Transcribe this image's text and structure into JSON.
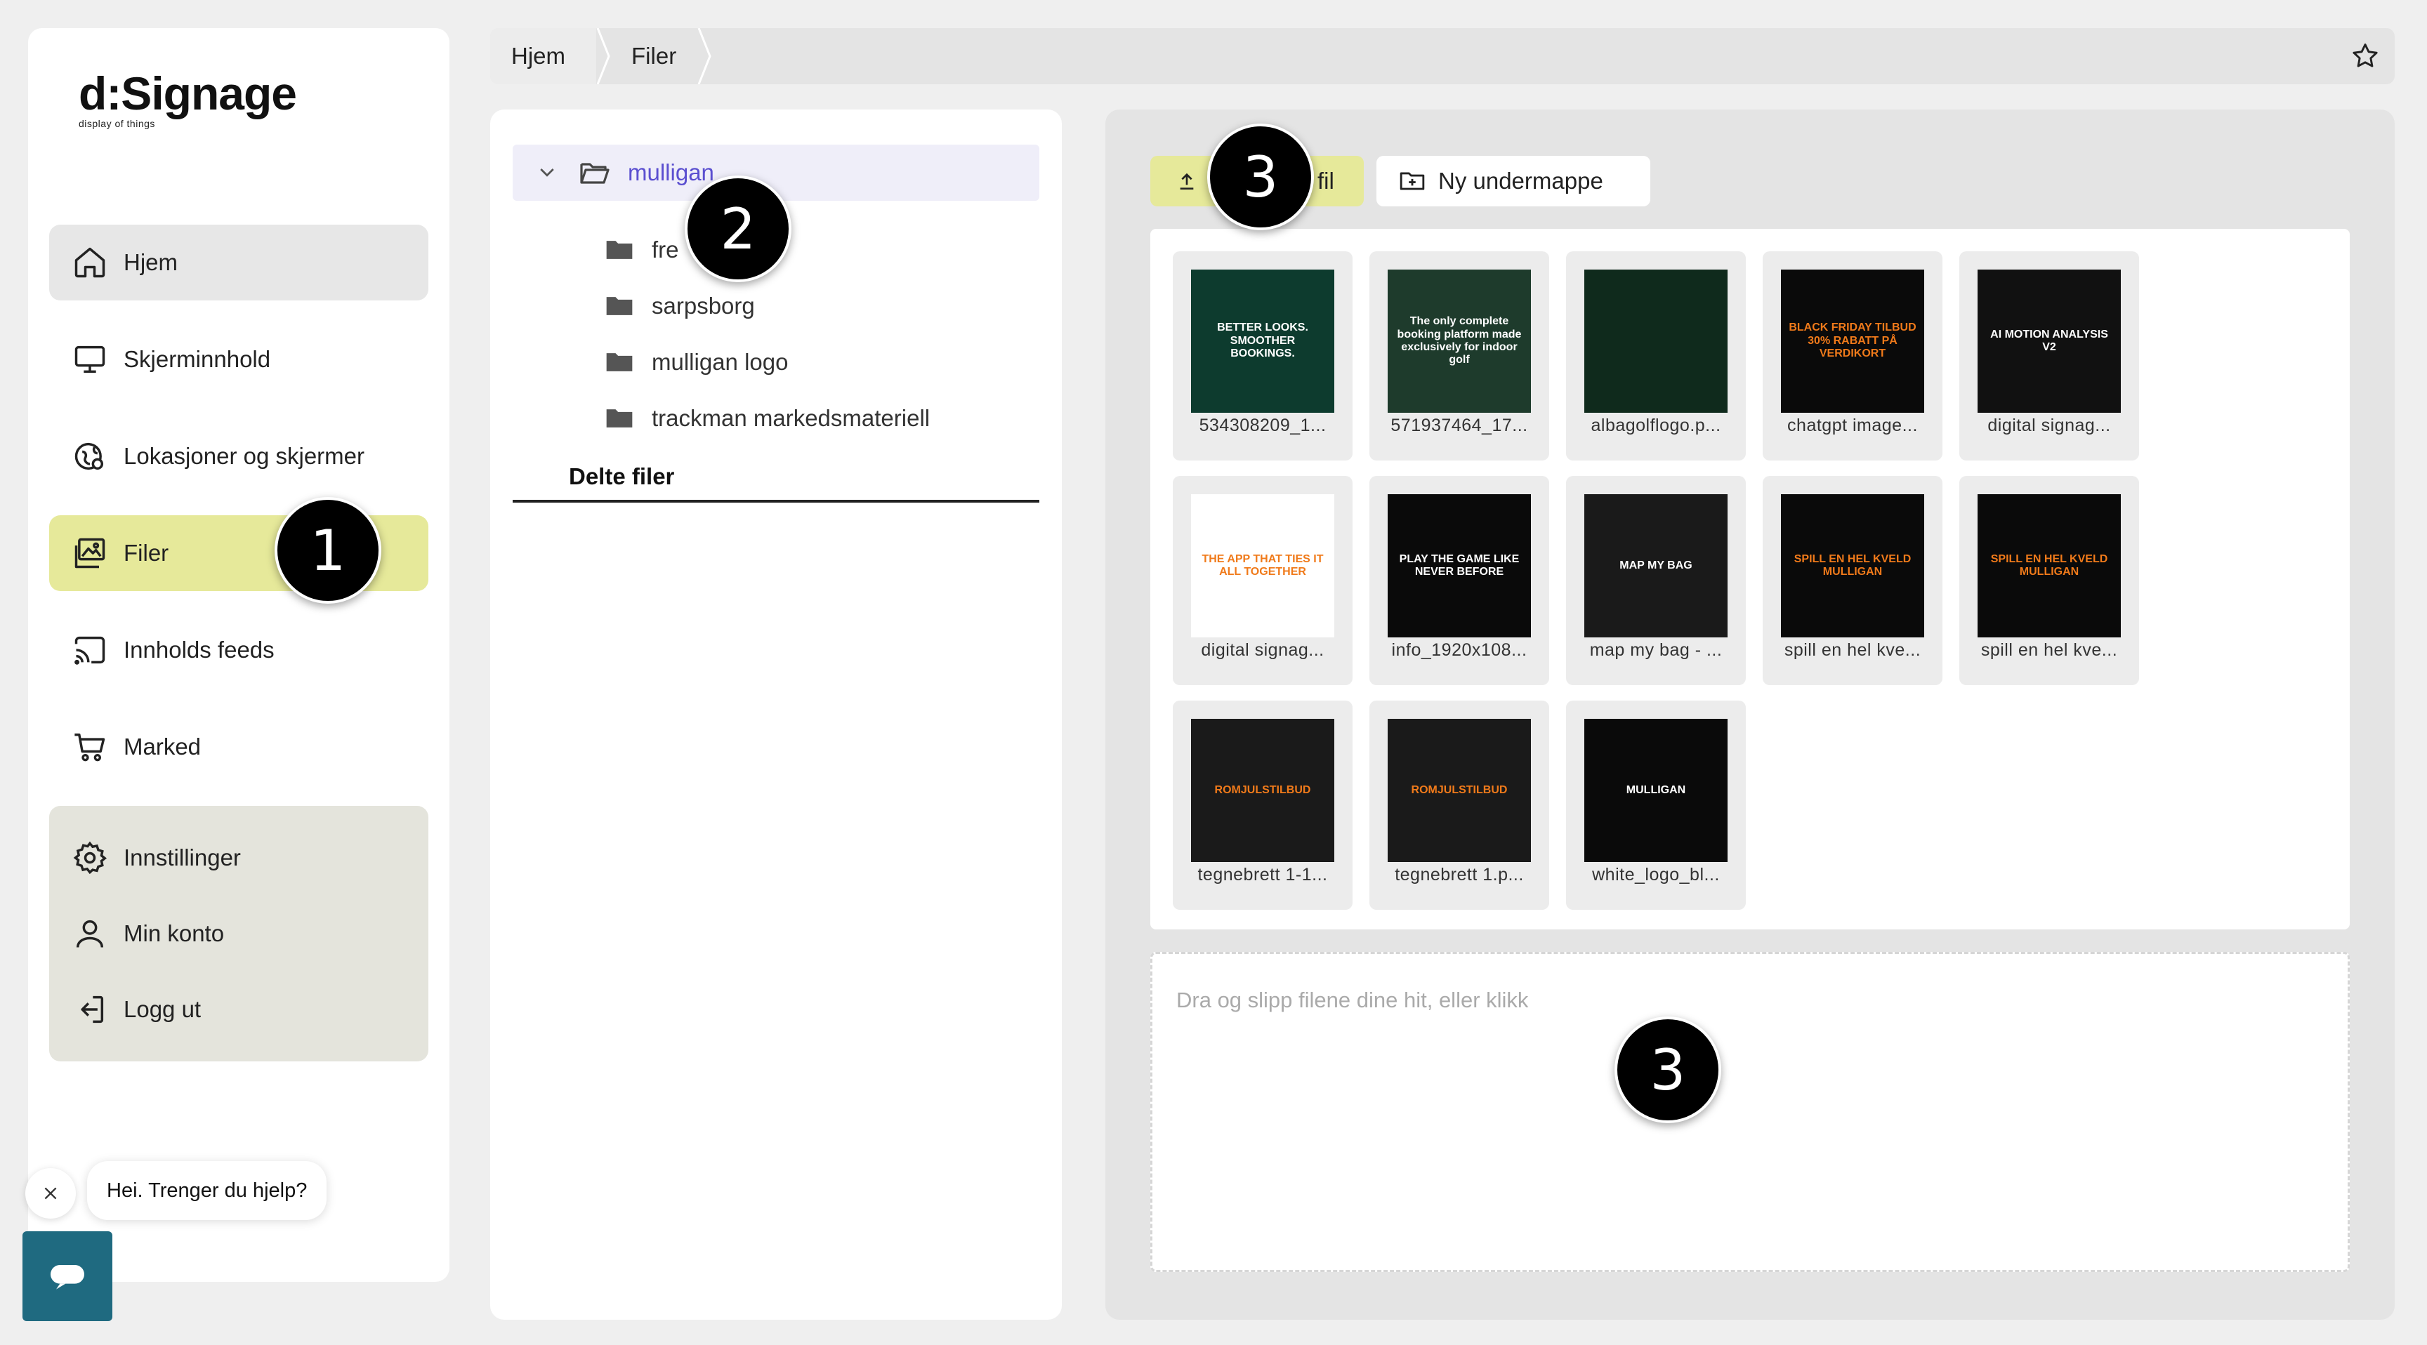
{
  "logo": {
    "brand": "d:Signage",
    "tagline": "display of things"
  },
  "sidebar": {
    "items": [
      {
        "label": "Hjem",
        "icon": "home-icon",
        "state": "hover"
      },
      {
        "label": "Skjerminnhold",
        "icon": "monitor-icon"
      },
      {
        "label": "Lokasjoner og skjermer",
        "icon": "location-icon"
      },
      {
        "label": "Filer",
        "icon": "image-icon",
        "state": "active"
      },
      {
        "label": "Innholds feeds",
        "icon": "cast-icon"
      },
      {
        "label": "Marked",
        "icon": "cart-icon"
      }
    ],
    "account": [
      {
        "label": "Innstillinger",
        "icon": "gear-icon"
      },
      {
        "label": "Min konto",
        "icon": "user-icon"
      },
      {
        "label": "Logg ut",
        "icon": "logout-icon"
      }
    ]
  },
  "help": {
    "message": "Hei. Trenger du hjelp?"
  },
  "breadcrumb": [
    "Hjem",
    "Filer"
  ],
  "tree": {
    "root": "mulligan",
    "children": [
      "fre",
      "sarpsborg",
      "mulligan logo",
      "trackman markedsmateriell"
    ],
    "shared_tab": "Delte filer"
  },
  "files": {
    "upload_label": "fil",
    "new_subfolder_label": "Ny undermappe",
    "items": [
      {
        "name": "534308209_1...",
        "thumb": {
          "bg": "#0d3b2e",
          "fg": "#ffffff",
          "text": "BETTER LOOKS. SMOOTHER BOOKINGS."
        }
      },
      {
        "name": "571937464_17...",
        "thumb": {
          "bg": "#1e3b2c",
          "fg": "#ffffff",
          "text": "The only complete booking platform made exclusively for indoor golf"
        }
      },
      {
        "name": "albagolflogo.p...",
        "thumb": {
          "bg": "#0f2a1c",
          "fg": "#c8a15a",
          "text": ""
        }
      },
      {
        "name": "chatgpt image...",
        "thumb": {
          "bg": "#0a0a0a",
          "fg": "#f07a1a",
          "text": "BLACK FRIDAY TILBUD 30% RABATT PÅ VERDIKORT"
        }
      },
      {
        "name": "digital signag...",
        "thumb": {
          "bg": "#111111",
          "fg": "#ffffff",
          "text": "AI MOTION ANALYSIS V2"
        }
      },
      {
        "name": "digital signag...",
        "thumb": {
          "bg": "#ffffff",
          "fg": "#f07a1a",
          "text": "THE APP THAT TIES IT ALL TOGETHER"
        }
      },
      {
        "name": "info_1920x108...",
        "thumb": {
          "bg": "#0a0a0a",
          "fg": "#ffffff",
          "text": "PLAY THE GAME LIKE NEVER BEFORE"
        }
      },
      {
        "name": "map my bag - ...",
        "thumb": {
          "bg": "#1a1a1a",
          "fg": "#ffffff",
          "text": "MAP MY BAG"
        }
      },
      {
        "name": "spill en hel kve...",
        "thumb": {
          "bg": "#0a0a0a",
          "fg": "#f07a1a",
          "text": "SPILL EN HEL KVELD MULLIGAN"
        }
      },
      {
        "name": "spill en hel kve...",
        "thumb": {
          "bg": "#0a0a0a",
          "fg": "#f07a1a",
          "text": "SPILL EN HEL KVELD MULLIGAN"
        }
      },
      {
        "name": "tegnebrett 1-1...",
        "thumb": {
          "bg": "#1a1a1a",
          "fg": "#f07a1a",
          "text": "ROMJULSTILBUD"
        }
      },
      {
        "name": "tegnebrett 1.p...",
        "thumb": {
          "bg": "#1a1a1a",
          "fg": "#f07a1a",
          "text": "ROMJULSTILBUD"
        }
      },
      {
        "name": "white_logo_bl...",
        "thumb": {
          "bg": "#0a0a0a",
          "fg": "#ffffff",
          "text": "MULLIGAN"
        }
      }
    ],
    "dropzone_label": "Dra og slipp filene dine hit, eller klikk"
  },
  "markers": [
    "1",
    "2",
    "3",
    "3"
  ],
  "colors": {
    "accent": "#e6e99a",
    "tree_active": "#5b4fd0",
    "help_button": "#1f6a80"
  }
}
